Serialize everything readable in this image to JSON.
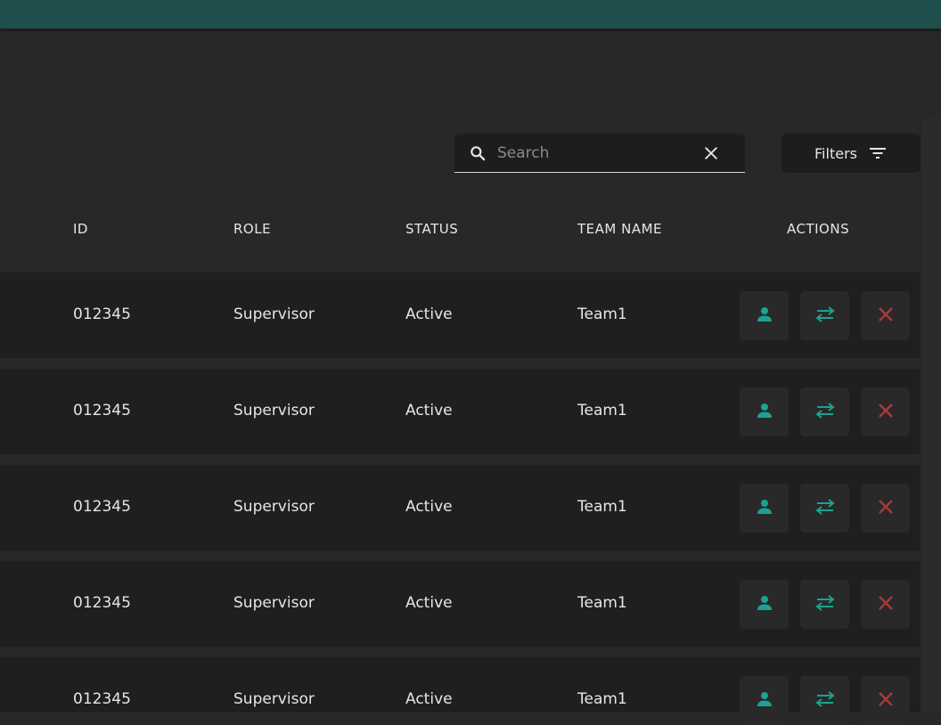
{
  "colors": {
    "topbar": "#1f4f4c",
    "accent_teal": "#1aa394",
    "danger_red": "#a83a3a"
  },
  "search": {
    "placeholder": "Search",
    "value": "",
    "icon": "search-icon",
    "clear_icon": "close-icon"
  },
  "filters": {
    "label": "Filters",
    "icon": "filter-list-icon"
  },
  "table": {
    "columns": {
      "id": "ID",
      "role": "ROLE",
      "status": "STATUS",
      "team": "TEAM NAME",
      "actions": "ACTIONS"
    },
    "rows": [
      {
        "id": "012345",
        "role": "Supervisor",
        "status": "Active",
        "team": "Team1"
      },
      {
        "id": "012345",
        "role": "Supervisor",
        "status": "Active",
        "team": "Team1"
      },
      {
        "id": "012345",
        "role": "Supervisor",
        "status": "Active",
        "team": "Team1"
      },
      {
        "id": "012345",
        "role": "Supervisor",
        "status": "Active",
        "team": "Team1"
      },
      {
        "id": "012345",
        "role": "Supervisor",
        "status": "Active",
        "team": "Team1"
      }
    ],
    "row_actions": [
      "person-icon",
      "swap-icon",
      "close-icon"
    ]
  }
}
